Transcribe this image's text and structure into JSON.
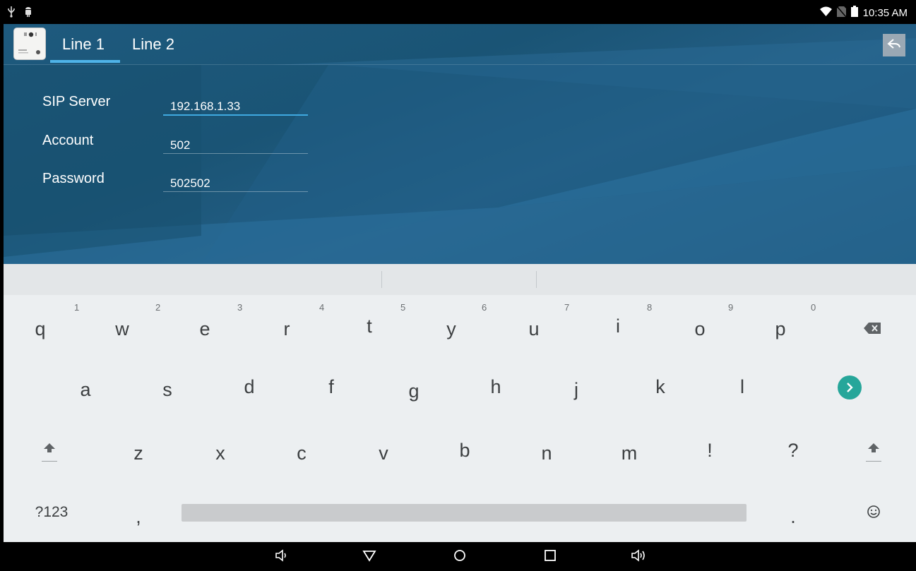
{
  "status_bar": {
    "left_icons": [
      "usb-icon",
      "android-debug-icon"
    ],
    "right_icons": [
      "wifi-icon",
      "no-sim-icon",
      "battery-icon"
    ],
    "time": "10:35 AM"
  },
  "header": {
    "tabs": [
      {
        "label": "Line 1",
        "active": true
      },
      {
        "label": "Line 2",
        "active": false
      }
    ],
    "back_icon": "reply-icon"
  },
  "form": {
    "fields": [
      {
        "label": "SIP Server",
        "value": "192.168.1.33",
        "focused": true
      },
      {
        "label": "Account",
        "value": "502",
        "focused": false
      },
      {
        "label": "Password",
        "value": "502502",
        "focused": false
      }
    ]
  },
  "keyboard": {
    "row1": [
      "q",
      "w",
      "e",
      "r",
      "t",
      "y",
      "u",
      "i",
      "o",
      "p"
    ],
    "row1_hints": [
      "1",
      "2",
      "3",
      "4",
      "5",
      "6",
      "7",
      "8",
      "9",
      "0"
    ],
    "row2": [
      "a",
      "s",
      "d",
      "f",
      "g",
      "h",
      "j",
      "k",
      "l"
    ],
    "row3": [
      "z",
      "x",
      "c",
      "v",
      "b",
      "n",
      "m",
      "!",
      "?"
    ],
    "symbols_key": "?123",
    "comma": ",",
    "period": ".",
    "icons": [
      "backspace-icon",
      "next-icon",
      "shift-icon",
      "emoji-icon"
    ],
    "accent_color": "#26a69a"
  },
  "nav_bar": {
    "icons": [
      "volume-down-icon",
      "back-icon",
      "home-icon",
      "recents-icon",
      "volume-up-icon"
    ]
  }
}
